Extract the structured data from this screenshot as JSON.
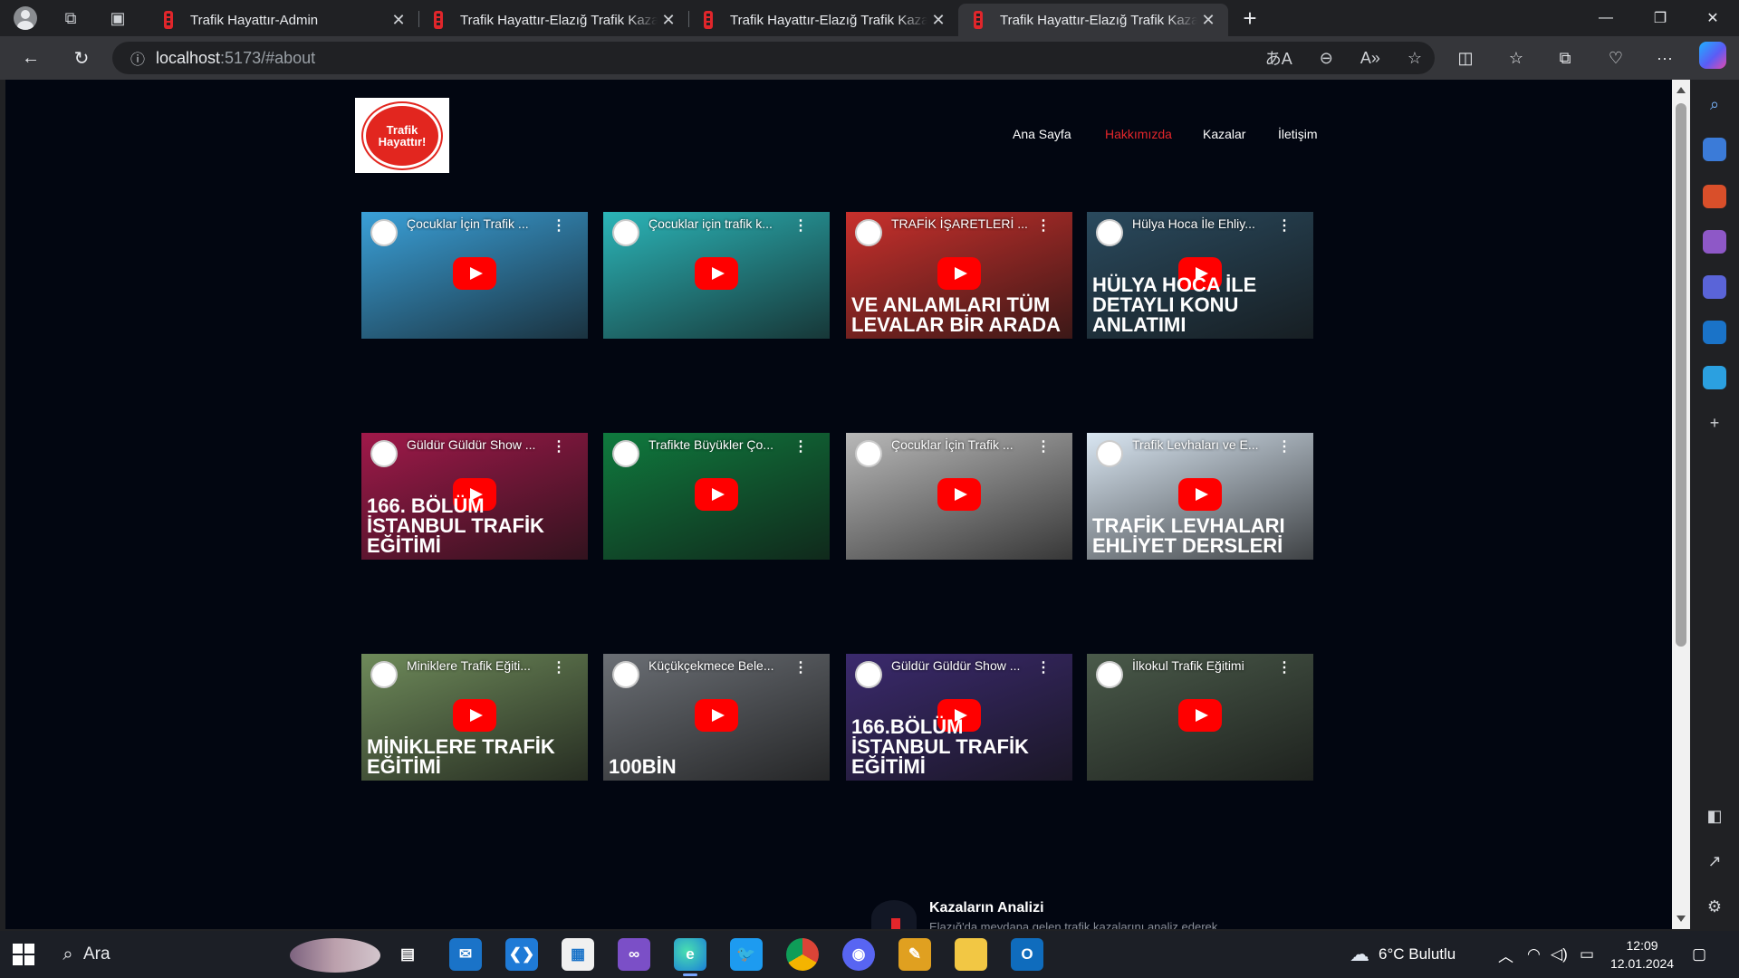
{
  "browser": {
    "tabs": [
      {
        "title": "Trafik Hayattır-Admin",
        "active": false
      },
      {
        "title": "Trafik Hayattır-Elazığ Trafik Kazası",
        "active": false
      },
      {
        "title": "Trafik Hayattır-Elazığ Trafik Kazası",
        "active": false
      },
      {
        "title": "Trafik Hayattır-Elazığ Trafik Kazası",
        "active": true
      }
    ],
    "url_host": "localhost",
    "url_path": ":5173/#about"
  },
  "site": {
    "logo_text": "Trafik Hayattır!",
    "nav": [
      {
        "label": "Ana Sayfa",
        "active": false
      },
      {
        "label": "Hakkımızda",
        "active": true
      },
      {
        "label": "Kazalar",
        "active": false
      },
      {
        "label": "İletişim",
        "active": false
      }
    ],
    "videos": [
      {
        "title": "Çocuklar İçin Trafik ...",
        "caption": "",
        "bg": "#3aa0d8"
      },
      {
        "title": "Çocuklar için trafik k...",
        "caption": "",
        "bg": "#2bb5b8"
      },
      {
        "title": "TRAFİK İŞARETLERİ ...",
        "caption": "VE ANLAMLARI TÜM LEVALAR BİR ARADA",
        "bg": "#c9302c"
      },
      {
        "title": "Hülya Hoca İle Ehliy...",
        "caption": "HÜLYA HOCA İLE DETAYLI KONU ANLATIMI",
        "bg": "#2a4a5e"
      },
      {
        "title": "Güldür Güldür Show ...",
        "caption": "166. BÖLÜM İSTANBUL TRAFİK EĞİTİMİ",
        "bg": "#a0194a"
      },
      {
        "title": "Trafikte Büyükler Ço...",
        "caption": "",
        "bg": "#0f7a3e"
      },
      {
        "title": "Çocuklar İçin Trafik ...",
        "caption": "",
        "bg": "#b8b8b8"
      },
      {
        "title": "Trafik Levhaları ve E...",
        "caption": "TRAFİK LEVHALARI EHLİYET DERSLERİ",
        "bg": "#d9e6f2"
      },
      {
        "title": "Miniklere Trafik Eğiti...",
        "caption": "MİNİKLERE TRAFİK EĞİTİMİ",
        "bg": "#6e8a5a"
      },
      {
        "title": "Küçükçekmece Bele...",
        "caption": "100BİN",
        "bg": "#6b6f75"
      },
      {
        "title": "Güldür Güldür Show ...",
        "caption": "166.BÖLÜM İSTANBUL TRAFİK EĞİTİMİ",
        "bg": "#3b2a6e"
      },
      {
        "title": "İlkokul Trafik Eğitimi",
        "caption": "",
        "bg": "#4a5a4a"
      }
    ],
    "analysis_title": "Kazaların Analizi",
    "analysis_desc": "Elazığ'da meydana gelen trafik kazalarını analiz ederek"
  },
  "taskbar": {
    "search_label": "Ara",
    "weather": "6°C Bulutlu",
    "time": "12:09",
    "date": "12.01.2024"
  }
}
